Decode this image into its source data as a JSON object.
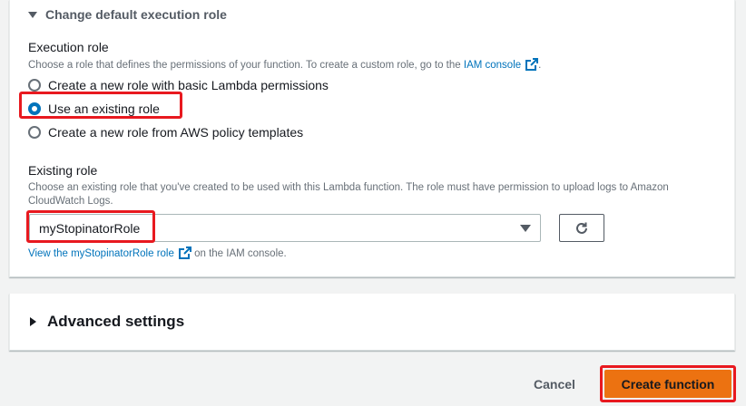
{
  "role_section": {
    "toggle_label": "Change default execution role",
    "execution_role": {
      "label": "Execution role",
      "description_prefix": "Choose a role that defines the permissions of your function. To create a custom role, go to the ",
      "description_link": "IAM console",
      "description_suffix": "."
    },
    "options": [
      {
        "label": "Create a new role with basic Lambda permissions",
        "checked": false
      },
      {
        "label": "Use an existing role",
        "checked": true
      },
      {
        "label": "Create a new role from AWS policy templates",
        "checked": false
      }
    ],
    "existing_role": {
      "label": "Existing role",
      "description": "Choose an existing role that you've created to be used with this Lambda function. The role must have permission to upload logs to Amazon CloudWatch Logs.",
      "selected_value": "myStopinatorRole",
      "view_link": "View the myStopinatorRole role",
      "view_suffix": "on the IAM console."
    }
  },
  "advanced": {
    "label": "Advanced settings"
  },
  "footer": {
    "cancel_label": "Cancel",
    "create_label": "Create function"
  },
  "colors": {
    "link": "#0073bb",
    "primary_button": "#ec7211",
    "highlight": "#e8191f"
  },
  "icons": {
    "section_caret": "caret-down-icon",
    "external_link": "external-link-icon",
    "refresh": "refresh-icon",
    "select_caret": "caret-down-icon",
    "advanced_caret": "caret-right-icon"
  }
}
